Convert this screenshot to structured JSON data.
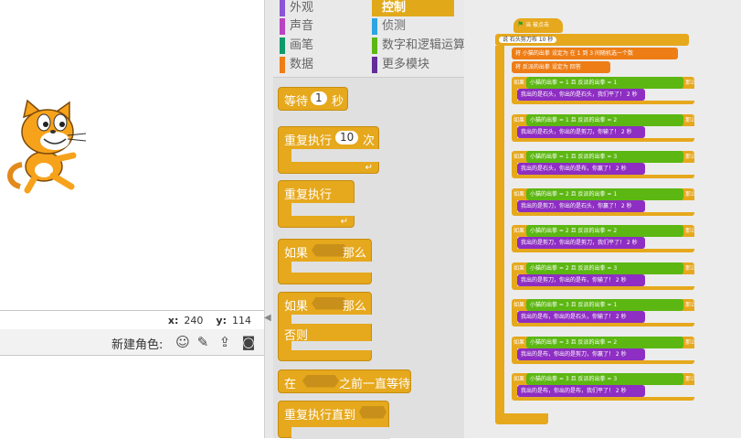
{
  "stage": {
    "sprite_name": "Scratch Cat",
    "x_label": "x:",
    "x_value": "240",
    "y_label": "y:",
    "y_value": "114"
  },
  "sprites_pane": {
    "new_sprite_label": "新建角色:",
    "tools": [
      "character-icon",
      "paintbrush-icon",
      "upload-icon",
      "camera-icon"
    ]
  },
  "categories": {
    "left": [
      {
        "label": "外观",
        "color": "#8a55d7"
      },
      {
        "label": "声音",
        "color": "#bb42c3"
      },
      {
        "label": "画笔",
        "color": "#0e9a6c"
      },
      {
        "label": "数据",
        "color": "#ee7d16"
      }
    ],
    "right": [
      {
        "label": "控制",
        "color": "#e1a91a",
        "selected": true
      },
      {
        "label": "侦测",
        "color": "#2ca5e2"
      },
      {
        "label": "数字和逻辑运算",
        "color": "#5cb712"
      },
      {
        "label": "更多模块",
        "color": "#632d99"
      }
    ]
  },
  "palette_blocks": {
    "wait": {
      "prefix": "等待",
      "value": "1",
      "suffix": "秒"
    },
    "repeat": {
      "prefix": "重复执行",
      "value": "10",
      "suffix": "次"
    },
    "forever": {
      "label": "重复执行"
    },
    "if_then": {
      "prefix": "如果",
      "suffix": "那么"
    },
    "if_else": {
      "prefix": "如果",
      "suffix": "那么",
      "else": "否则"
    },
    "wait_until": {
      "prefix": "在",
      "suffix": "之前一直等待"
    },
    "repeat_until": {
      "prefix": "重复执行直到"
    }
  },
  "script": {
    "hat": "当 被点击",
    "say_line": "说 石头剪刀布 10 秒",
    "set1": "将 小猫的出拳 设定为 在 1 到 3 间随机选一个数",
    "set2": "将 反派的出拳 设定为 回答",
    "if_label": "如果",
    "then_label": "那么",
    "and_label": "且",
    "cat_label": "小猫的出拳",
    "enemy_label": "反派的出拳",
    "rows": [
      {
        "a": "1",
        "b": "1",
        "say": "我出的是石头，你出的是石头，我们平了！ 2 秒"
      },
      {
        "a": "1",
        "b": "2",
        "say": "我出的是石头，你出的是剪刀，你输了！ 2 秒"
      },
      {
        "a": "1",
        "b": "3",
        "say": "我出的是石头，你出的是布，你赢了！ 2 秒"
      },
      {
        "a": "2",
        "b": "1",
        "say": "我出的是剪刀，你出的是石头，你赢了！ 2 秒"
      },
      {
        "a": "2",
        "b": "2",
        "say": "我出的是剪刀，你出的是剪刀，我们平了！ 2 秒"
      },
      {
        "a": "2",
        "b": "3",
        "say": "我出的是剪刀，你出的是布，你输了！ 2 秒"
      },
      {
        "a": "3",
        "b": "1",
        "say": "我出的是布，你出的是石头，你输了！ 2 秒"
      },
      {
        "a": "3",
        "b": "2",
        "say": "我出的是布，你出的是剪刀，你赢了！ 2 秒"
      },
      {
        "a": "3",
        "b": "3",
        "say": "我出的是布，你出的是布，我们平了！ 2 秒"
      }
    ]
  }
}
